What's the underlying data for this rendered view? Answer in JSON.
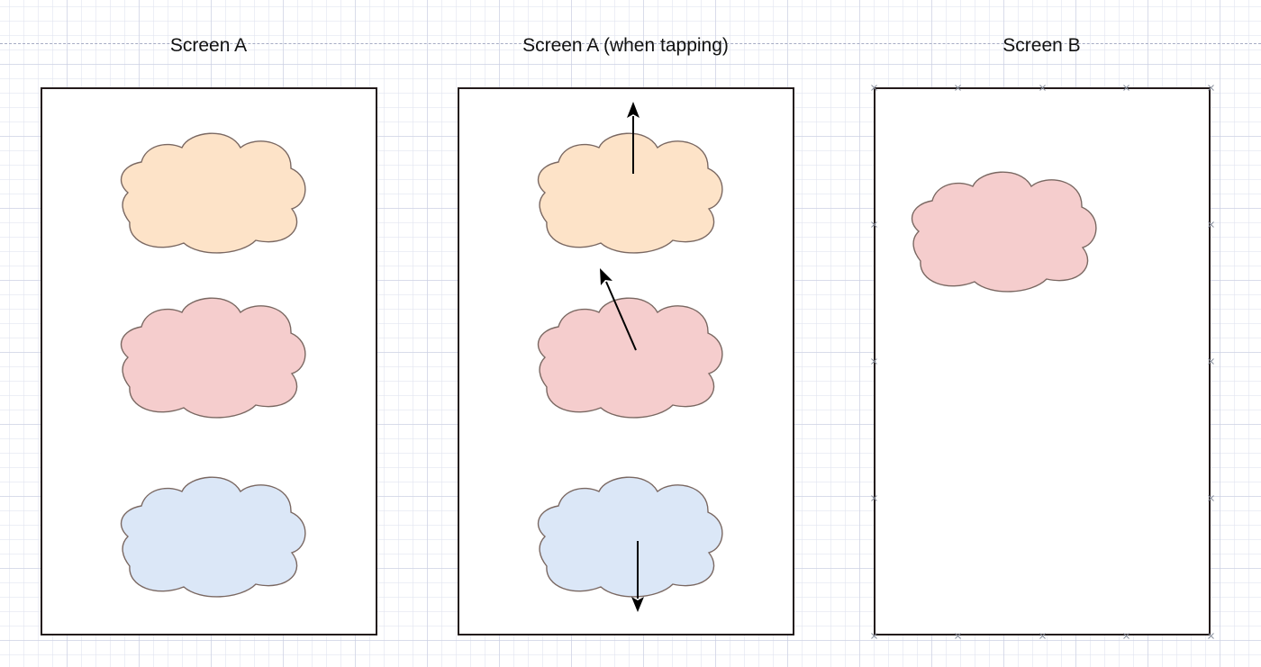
{
  "titles": {
    "screen_a": "Screen A",
    "screen_a_tapping": "Screen A (when tapping)",
    "screen_b": "Screen B"
  },
  "colors": {
    "orange_cloud": "#fde3c8",
    "pink_cloud": "#f5cdcd",
    "blue_cloud": "#dbe7f7",
    "cloud_stroke": "#7a6862",
    "frame_border": "#231a1a",
    "arrow": "#000000"
  },
  "diagram": {
    "screens": [
      {
        "id": "screen-a",
        "clouds": [
          "orange",
          "pink",
          "blue"
        ],
        "arrows": 0
      },
      {
        "id": "screen-a-tap",
        "clouds": [
          "orange",
          "pink",
          "blue"
        ],
        "arrows": 3
      },
      {
        "id": "screen-b",
        "clouds": [
          "pink"
        ],
        "arrows": 0,
        "selected": true
      }
    ]
  }
}
